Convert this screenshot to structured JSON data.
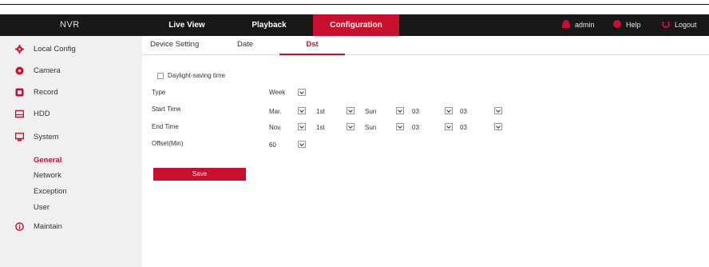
{
  "app": {
    "brand": "NVR"
  },
  "nav": {
    "live_view": "Live View",
    "playback": "Playback",
    "configuration": "Configuration"
  },
  "user_menu": {
    "admin": "admin",
    "help": "Help",
    "logout": "Logout"
  },
  "sidebar": {
    "items": [
      {
        "label": "Local Config"
      },
      {
        "label": "Camera"
      },
      {
        "label": "Record"
      },
      {
        "label": "HDD"
      },
      {
        "label": "System"
      },
      {
        "label": "Maintain"
      }
    ],
    "system_sub": [
      {
        "label": "General"
      },
      {
        "label": "Network"
      },
      {
        "label": "Exception"
      },
      {
        "label": "User"
      }
    ]
  },
  "tabs": {
    "device_setting": "Device Setting",
    "date": "Date",
    "dst": "Dst"
  },
  "form": {
    "daylight_saving_label": "Daylight-saving time",
    "type_label": "Type",
    "type_value": "Week",
    "start_label": "Start Time",
    "start": {
      "month": "Mar.",
      "week": "1st",
      "day": "Sun",
      "hour": "03",
      "minute": "03"
    },
    "end_label": "End Time",
    "end": {
      "month": "Nov.",
      "week": "1st",
      "day": "Sun",
      "hour": "03",
      "minute": "03"
    },
    "offset_label": "Offset(Min)",
    "offset_value": "60",
    "save_label": "Save"
  },
  "colors": {
    "accent": "#c8102e",
    "topbar": "#181818",
    "sidebar": "#f0f0f0"
  }
}
